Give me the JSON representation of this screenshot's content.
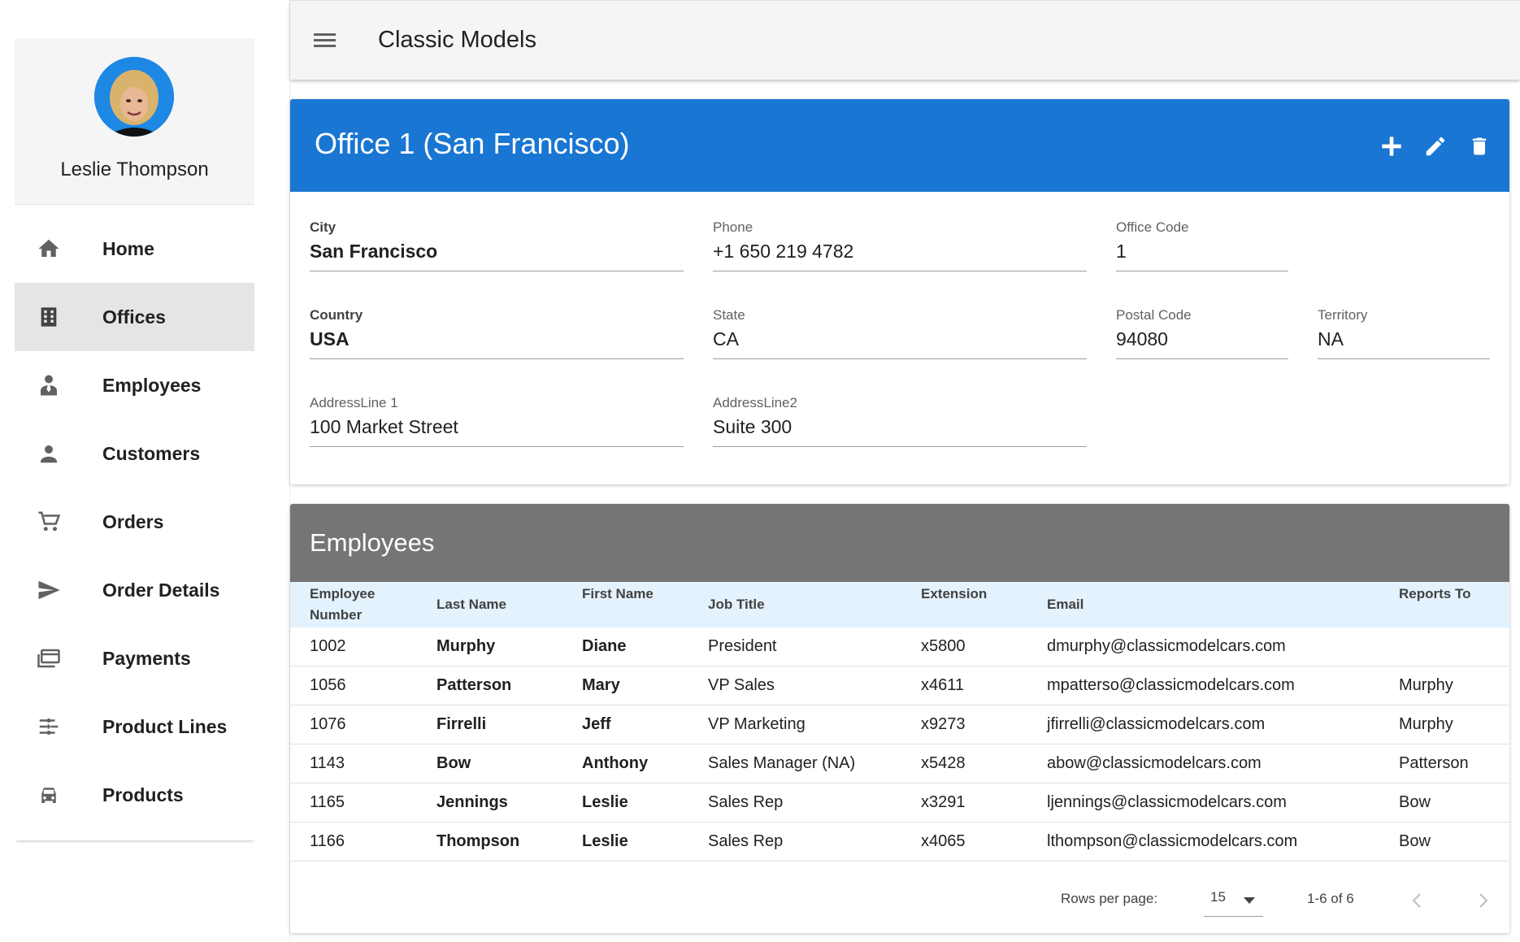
{
  "app": {
    "title": "Classic Models"
  },
  "user": {
    "name": "Leslie Thompson"
  },
  "sidebar": {
    "items": [
      {
        "label": "Home",
        "icon": "home-icon"
      },
      {
        "label": "Offices",
        "icon": "building-icon",
        "active": true
      },
      {
        "label": "Employees",
        "icon": "employee-icon"
      },
      {
        "label": "Customers",
        "icon": "person-icon"
      },
      {
        "label": "Orders",
        "icon": "cart-icon"
      },
      {
        "label": "Order Details",
        "icon": "send-icon"
      },
      {
        "label": "Payments",
        "icon": "payments-icon"
      },
      {
        "label": "Product Lines",
        "icon": "product-lines-icon"
      },
      {
        "label": "Products",
        "icon": "car-icon"
      }
    ]
  },
  "office": {
    "title": "Office 1 (San Francisco)",
    "actions": [
      "add-icon",
      "edit-icon",
      "delete-icon"
    ],
    "fields": {
      "city": {
        "label": "City",
        "value": "San Francisco"
      },
      "phone": {
        "label": "Phone",
        "value": "+1 650 219 4782"
      },
      "office_code": {
        "label": "Office Code",
        "value": "1"
      },
      "country": {
        "label": "Country",
        "value": "USA"
      },
      "state": {
        "label": "State",
        "value": "CA"
      },
      "postal_code": {
        "label": "Postal Code",
        "value": "94080"
      },
      "territory": {
        "label": "Territory",
        "value": "NA"
      },
      "address1": {
        "label": "AddressLine 1",
        "value": "100 Market Street"
      },
      "address2": {
        "label": "AddressLine2",
        "value": "Suite 300"
      }
    }
  },
  "employees": {
    "title": "Employees",
    "columns": {
      "number_line1": "Employee",
      "number_line2": "Number",
      "last_name": "Last Name",
      "first_name": "First Name",
      "job_title": "Job Title",
      "extension": "Extension",
      "email": "Email",
      "reports_to": "Reports To"
    },
    "rows": [
      {
        "number": "1002",
        "last_name": "Murphy",
        "first_name": "Diane",
        "job_title": "President",
        "extension": "x5800",
        "email": "dmurphy@classicmodelcars.com",
        "reports_to": ""
      },
      {
        "number": "1056",
        "last_name": "Patterson",
        "first_name": "Mary",
        "job_title": "VP Sales",
        "extension": "x4611",
        "email": "mpatterso@classicmodelcars.com",
        "reports_to": "Murphy"
      },
      {
        "number": "1076",
        "last_name": "Firrelli",
        "first_name": "Jeff",
        "job_title": "VP Marketing",
        "extension": "x9273",
        "email": "jfirrelli@classicmodelcars.com",
        "reports_to": "Murphy"
      },
      {
        "number": "1143",
        "last_name": "Bow",
        "first_name": "Anthony",
        "job_title": "Sales Manager (NA)",
        "extension": "x5428",
        "email": "abow@classicmodelcars.com",
        "reports_to": "Patterson"
      },
      {
        "number": "1165",
        "last_name": "Jennings",
        "first_name": "Leslie",
        "job_title": "Sales Rep",
        "extension": "x3291",
        "email": "ljennings@classicmodelcars.com",
        "reports_to": "Bow"
      },
      {
        "number": "1166",
        "last_name": "Thompson",
        "first_name": "Leslie",
        "job_title": "Sales Rep",
        "extension": "x4065",
        "email": "lthompson@classicmodelcars.com",
        "reports_to": "Bow"
      }
    ],
    "pagination": {
      "rows_per_page_label": "Rows per page:",
      "rows_per_page": "15",
      "range": "1-6 of 6"
    }
  },
  "colors": {
    "office_header": "#1976d2",
    "employees_header": "#757575",
    "table_header": "#e3f2fd",
    "active_menu": "#e5e5e5"
  }
}
